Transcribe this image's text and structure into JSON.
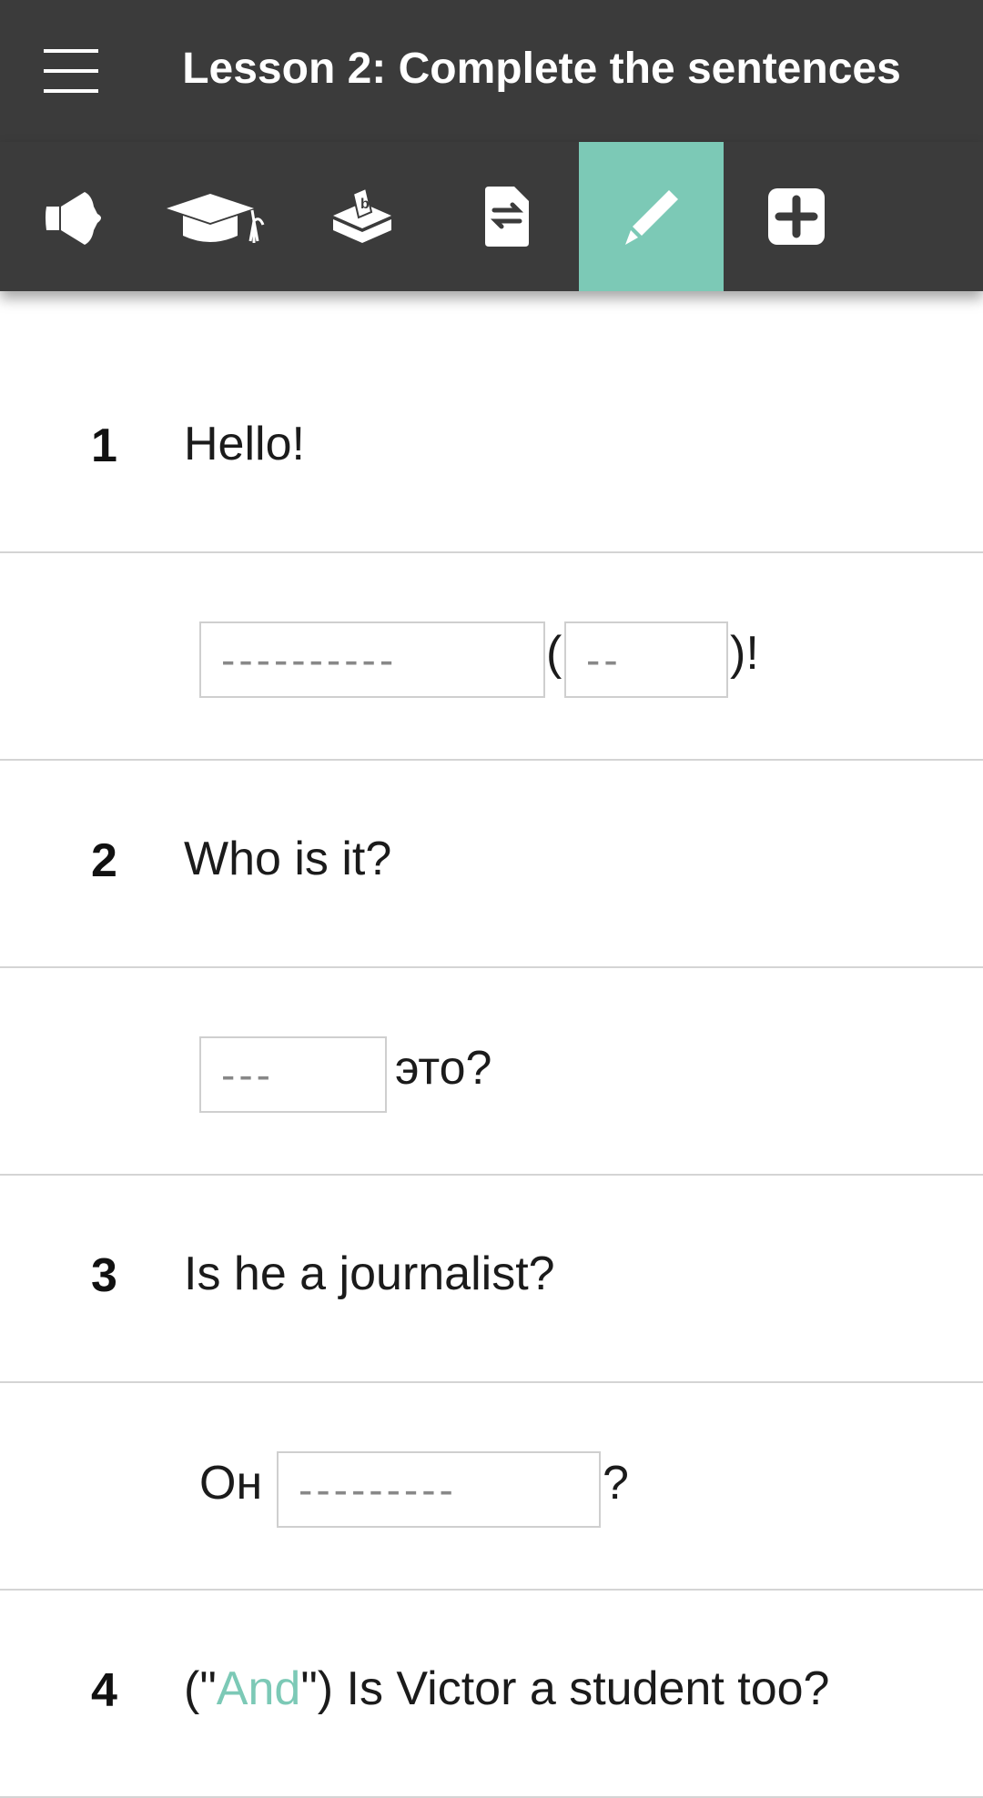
{
  "header": {
    "title": "Lesson 2: Complete the sentences",
    "menu_icon": "hamburger-menu-icon"
  },
  "toolbar": {
    "items": [
      {
        "icon": "megaphone-icon",
        "active": false
      },
      {
        "icon": "graduation-cap-icon",
        "active": false
      },
      {
        "icon": "ballot-box-icon",
        "active": false
      },
      {
        "icon": "document-swap-icon",
        "active": false
      },
      {
        "icon": "pencil-icon",
        "active": true
      },
      {
        "icon": "plus-square-icon",
        "active": false
      }
    ],
    "accent_color": "#7cc9b6"
  },
  "exercises": [
    {
      "number": "1",
      "prompt": "Hello!",
      "answer": {
        "blank1": "----------",
        "glue1": "(",
        "blank2": "--",
        "glue2": ")!"
      }
    },
    {
      "number": "2",
      "prompt": "Who is it?",
      "answer": {
        "blank1": "---",
        "glue1": "это?"
      }
    },
    {
      "number": "3",
      "prompt": "Is he a journalist?",
      "answer": {
        "glue0": "Он",
        "blank1": "---------",
        "glue1": "?"
      }
    },
    {
      "number": "4",
      "prompt_pre": "(\"",
      "prompt_accent": "And",
      "prompt_post": "\") Is Victor a student too?"
    }
  ]
}
